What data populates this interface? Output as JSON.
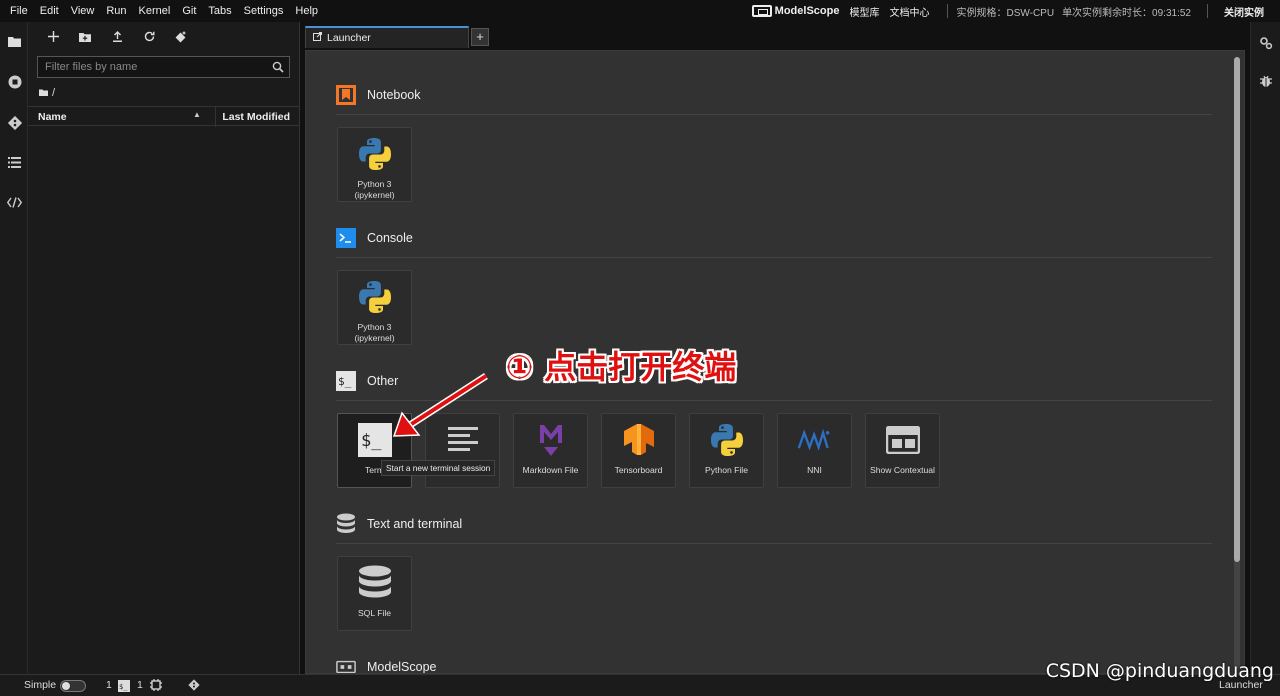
{
  "menubar": {
    "items": [
      "File",
      "Edit",
      "View",
      "Run",
      "Kernel",
      "Git",
      "Tabs",
      "Settings",
      "Help"
    ],
    "brand": "ModelScope",
    "links": [
      "模型库",
      "文档中心"
    ],
    "spec": "实例规格：DSW-CPU",
    "remaining": "单次实例剩余时长：09:31:52",
    "close": "关闭实例"
  },
  "filebrowser": {
    "search_placeholder": "Filter files by name",
    "breadcrumb": "/",
    "col_name": "Name",
    "col_modified": "Last Modified"
  },
  "tabs": {
    "launcher": "Launcher",
    "add": "+"
  },
  "launcher": {
    "sections": {
      "notebook": "Notebook",
      "console": "Console",
      "other": "Other",
      "text_terminal": "Text and terminal",
      "modelscope": "ModelScope"
    },
    "notebook_cards": [
      {
        "label": "Python 3 (ipykernel)",
        "icon": "python-logo"
      }
    ],
    "console_cards": [
      {
        "label": "Python 3 (ipykernel)",
        "icon": "python-logo"
      }
    ],
    "other_cards": [
      {
        "label": "Term",
        "icon": "terminal-icon"
      },
      {
        "label": "",
        "icon": "text-file-icon"
      },
      {
        "label": "Markdown File",
        "icon": "markdown-icon"
      },
      {
        "label": "Tensorboard",
        "icon": "tensorflow-icon"
      },
      {
        "label": "Python File",
        "icon": "python-logo"
      },
      {
        "label": "NNI",
        "icon": "nni-icon"
      },
      {
        "label": "Show Contextual",
        "icon": "contextual-help-icon"
      }
    ],
    "text_terminal_cards": [
      {
        "label": "SQL File",
        "icon": "database-icon"
      }
    ],
    "tooltip": "Start a new terminal session"
  },
  "annotation": "① 点击打开终端",
  "statusbar": {
    "mode": "Simple",
    "kernels": "1",
    "terminals": "1",
    "launcher": "Launcher"
  },
  "watermark": "CSDN @pinduangduang",
  "colors": {
    "accent": "#4a90d9",
    "notebook_orange": "#f37726",
    "console_blue": "#1f8ded",
    "annotation_red": "#e01010"
  }
}
